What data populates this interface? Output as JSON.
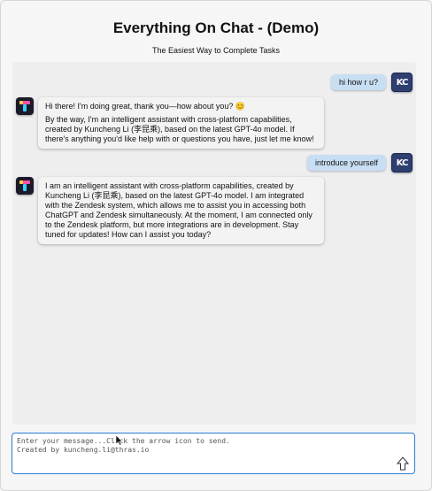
{
  "header": {
    "title": "Everything On Chat - (Demo)",
    "subtitle": "The Easiest Way to Complete Tasks"
  },
  "conversation": [
    {
      "role": "user",
      "text": "hi how r u?",
      "avatar": "KC"
    },
    {
      "role": "assistant",
      "paragraphs": [
        "Hi there! I'm doing great, thank you—how about you? 😊",
        "By the way, I'm an intelligent assistant with cross-platform capabilities, created by Kuncheng Li (李昆乘), based on the latest GPT-4o model. If there's anything you'd like help with or questions you have, just let me know!"
      ]
    },
    {
      "role": "user",
      "text": "introduce yourself",
      "avatar": "KC"
    },
    {
      "role": "assistant",
      "paragraphs": [
        "I am an intelligent assistant with cross-platform capabilities, created by Kuncheng Li (李昆乘), based on the latest GPT-4o model. I am integrated with the Zendesk system, which allows me to assist you in accessing both ChatGPT and Zendesk simultaneously. At the moment, I am connected only to the Zendesk platform, but more integrations are in development. Stay tuned for updates! How can I assist you today?"
      ]
    }
  ],
  "composer": {
    "placeholder": "Enter your message...Click the arrow icon to send.\nCreated by kuncheng.li@thras.io",
    "send_icon": "arrow-up-icon"
  },
  "colors": {
    "user_bubble": "#c8def3",
    "assistant_bubble": "#f3f3f3",
    "input_border": "#2a7bd4",
    "user_avatar": "#2e3f70"
  }
}
